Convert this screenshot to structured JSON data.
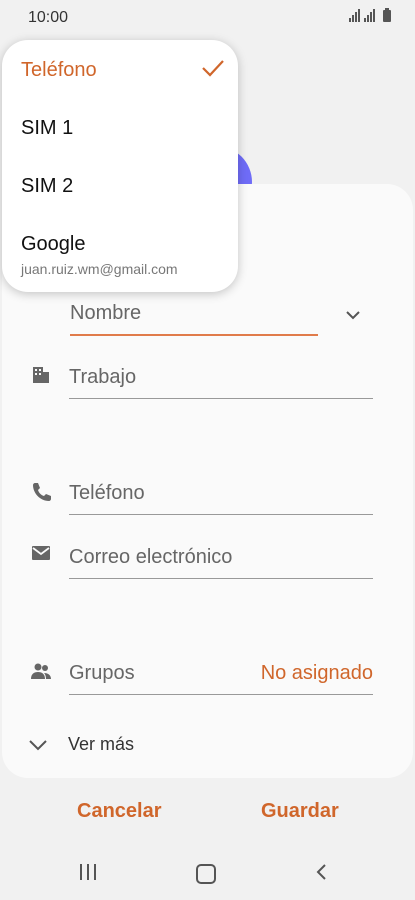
{
  "status_bar": {
    "time": "10:00"
  },
  "dropdown": {
    "items": [
      {
        "label": "Teléfono",
        "selected": true
      },
      {
        "label": "SIM 1"
      },
      {
        "label": "SIM 2"
      },
      {
        "label": "Google",
        "sublabel": "juan.ruiz.wm@gmail.com"
      }
    ]
  },
  "form": {
    "nombre": "Nombre",
    "trabajo": "Trabajo",
    "telefono": "Teléfono",
    "correo": "Correo electrónico",
    "grupos_label": "Grupos",
    "grupos_value": "No asignado",
    "ver_mas": "Ver más"
  },
  "actions": {
    "cancel": "Cancelar",
    "save": "Guardar"
  },
  "colors": {
    "accent": "#d0662b",
    "avatar": "#6f6cf7"
  }
}
